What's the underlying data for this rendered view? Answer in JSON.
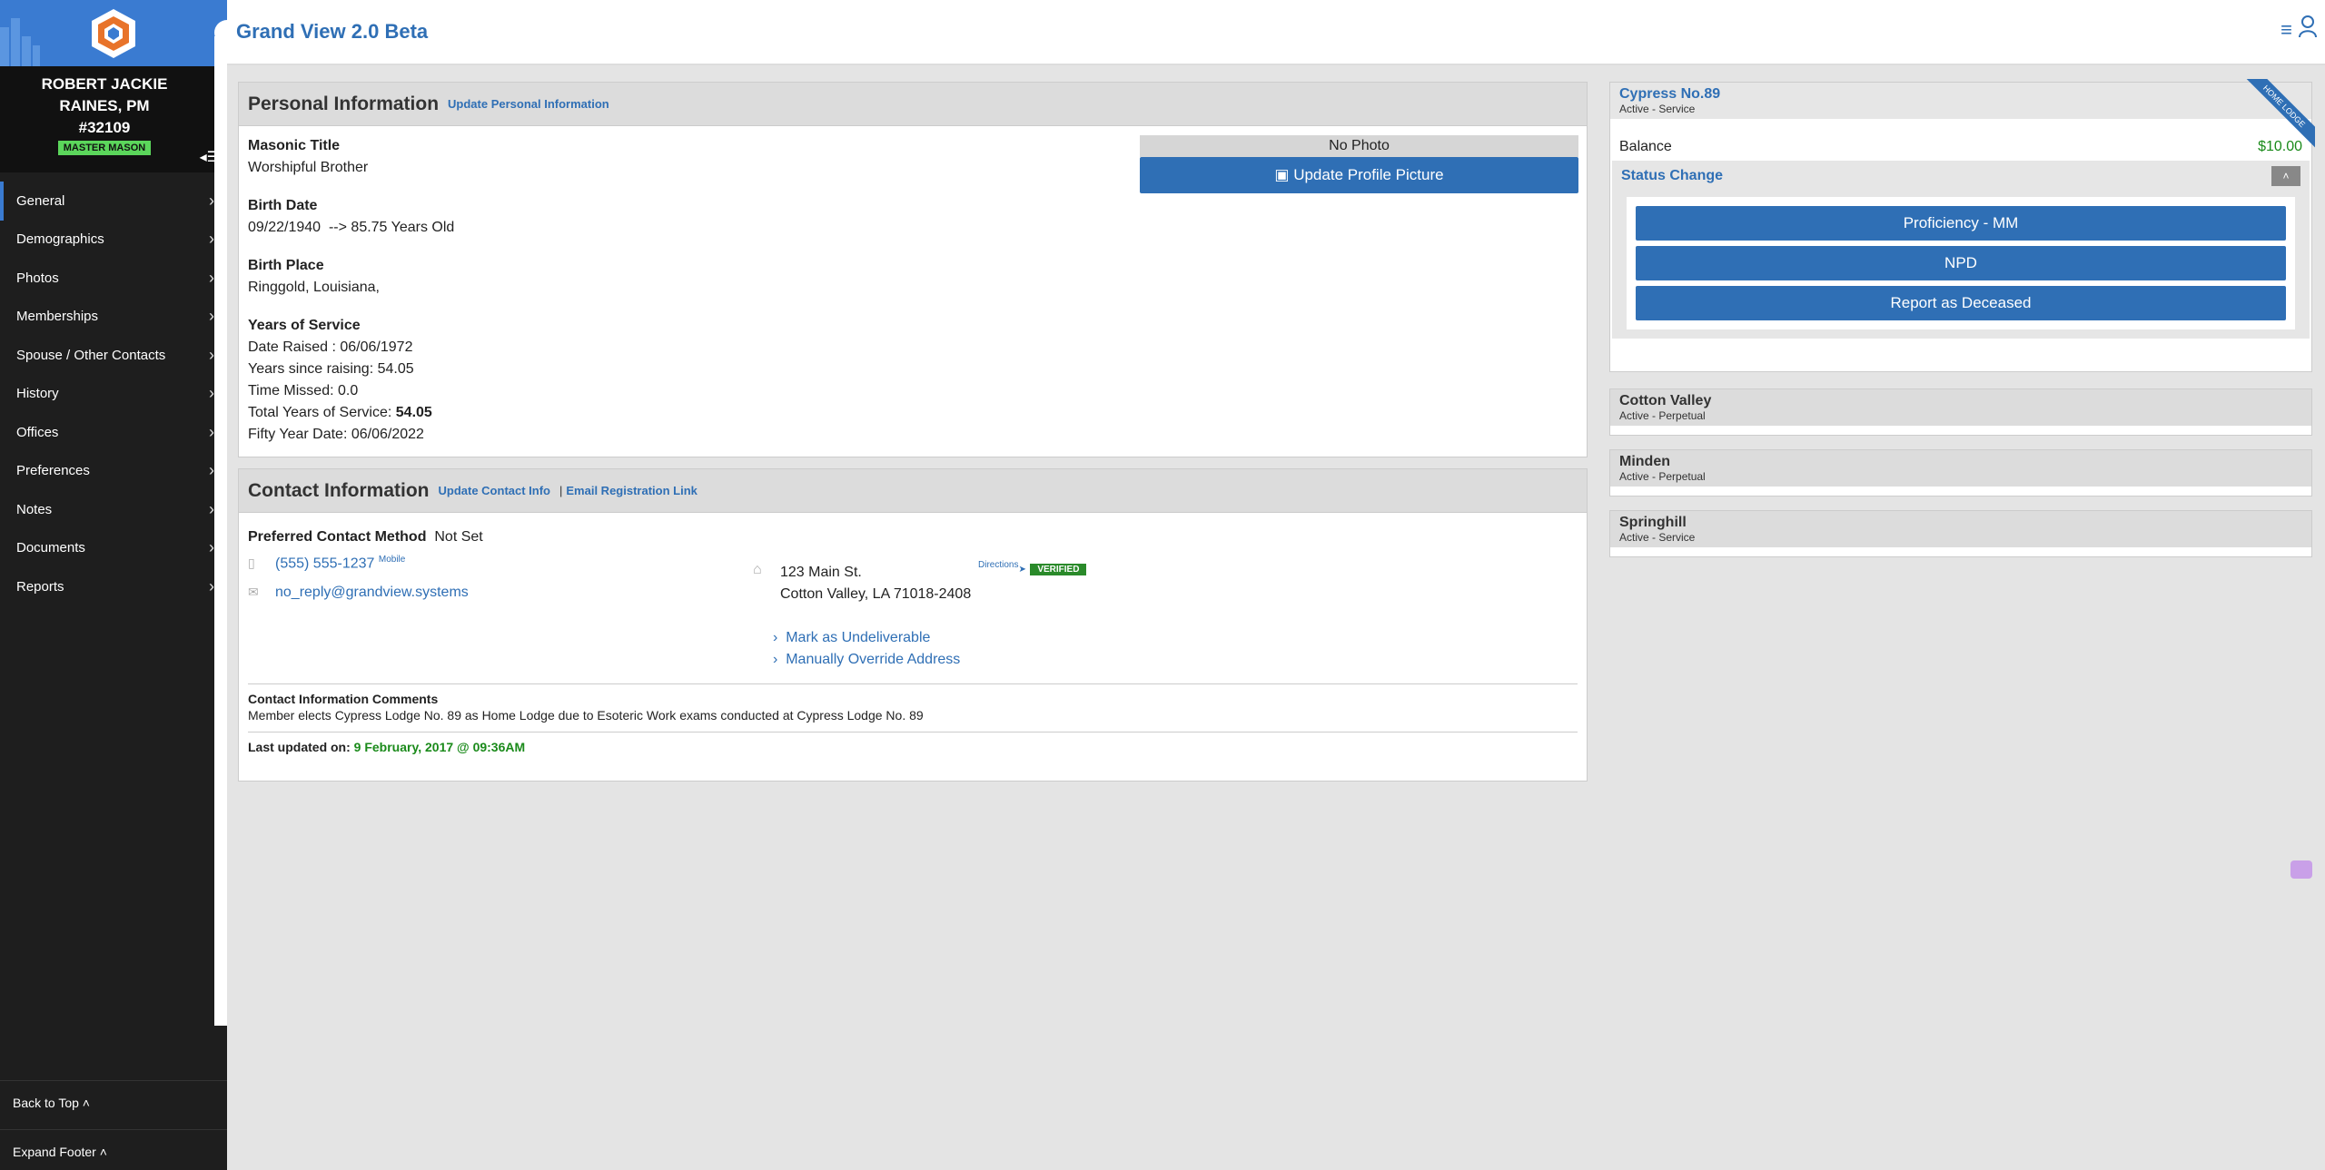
{
  "app": {
    "title": "Grand View 2.0 Beta"
  },
  "user": {
    "name": "ROBERT JACKIE RAINES, PM",
    "number": "#32109",
    "badge": "MASTER MASON"
  },
  "sidebar": {
    "items": [
      {
        "label": "General"
      },
      {
        "label": "Demographics"
      },
      {
        "label": "Photos"
      },
      {
        "label": "Memberships"
      },
      {
        "label": "Spouse / Other Contacts"
      },
      {
        "label": "History"
      },
      {
        "label": "Offices"
      },
      {
        "label": "Preferences"
      },
      {
        "label": "Notes"
      },
      {
        "label": "Documents"
      },
      {
        "label": "Reports"
      }
    ],
    "back_to_top": "Back to Top",
    "expand_footer": "Expand Footer"
  },
  "personal": {
    "heading": "Personal Information",
    "update_link": "Update Personal Information",
    "masonic_title_label": "Masonic Title",
    "masonic_title": "Worshipful Brother",
    "birth_date_label": "Birth Date",
    "birth_date": "09/22/1940  --> 85.75 Years Old",
    "birth_place_label": "Birth Place",
    "birth_place": "Ringgold, Louisiana,",
    "years_label": "Years of Service",
    "date_raised": "Date Raised : 06/06/1972",
    "years_since": "Years since raising: 54.05",
    "time_missed": "Time Missed: 0.0",
    "total_label": "Total Years of Service: ",
    "total_value": "54.05",
    "fifty_year": "Fifty Year Date: 06/06/2022",
    "no_photo": "No Photo",
    "update_photo": "Update Profile Picture"
  },
  "contact": {
    "heading": "Contact Information",
    "update_link": "Update Contact Info",
    "sep": "|",
    "email_link": "Email Registration Link",
    "preferred_label": "Preferred Contact Method",
    "preferred_value": "Not Set",
    "phone": "(555) 555-1237",
    "phone_type": "Mobile",
    "email": "no_reply@grandview.systems",
    "address1": "123 Main St.",
    "address2": "Cotton Valley, LA 71018-2408",
    "directions": "Directions",
    "verified": "VERIFIED",
    "mark_undeliverable": "Mark as Undeliverable",
    "override": "Manually Override Address",
    "comments_label": "Contact Information Comments",
    "comments": "Member elects Cypress Lodge No. 89 as Home Lodge due to Esoteric Work exams conducted at Cypress Lodge No. 89",
    "updated_label": "Last updated on: ",
    "updated_value": "9 February, 2017 @ 09:36AM"
  },
  "lodges": {
    "home": {
      "name": "Cypress No.89",
      "status": "Active  - Service",
      "ribbon": "HOME LODGE",
      "balance_label": "Balance",
      "balance": "$10.00",
      "status_change": "Status Change",
      "buttons": [
        "Proficiency - MM",
        "NPD",
        "Report as Deceased"
      ]
    },
    "others": [
      {
        "name": "Cotton Valley",
        "status": "Active  - Perpetual"
      },
      {
        "name": "Minden",
        "status": "Active  - Perpetual"
      },
      {
        "name": "Springhill",
        "status": "Active  - Service"
      }
    ]
  },
  "colors": {
    "accent": "#2f6fb5",
    "sidebar": "#1e1e1e",
    "badge": "#5bd65b",
    "verified": "#2a8a2a",
    "updated": "#1a8a1a"
  }
}
